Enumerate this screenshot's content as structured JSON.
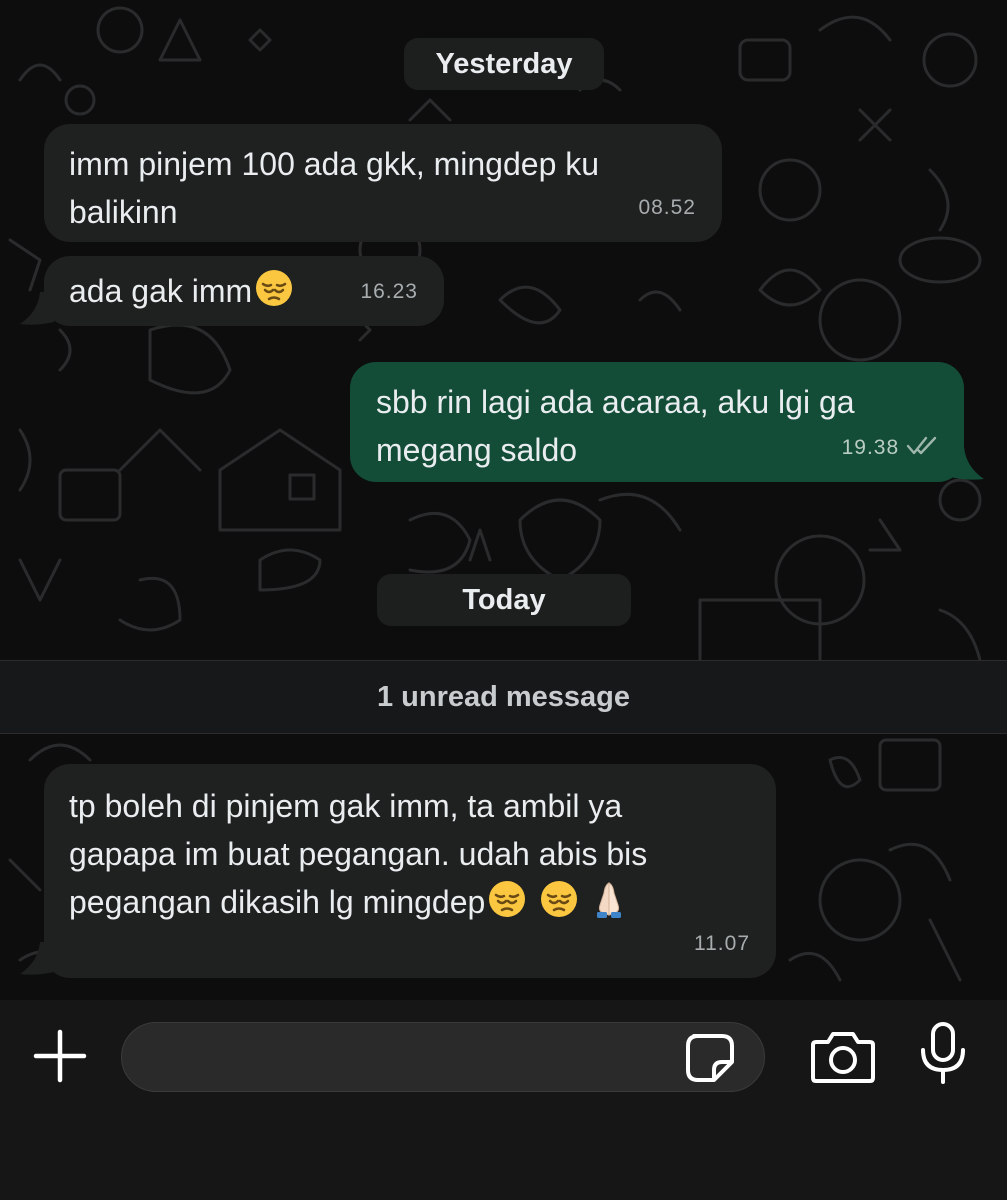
{
  "chat": {
    "date_yesterday": "Yesterday",
    "date_today": "Today",
    "unread_label": "1 unread message",
    "messages": [
      {
        "direction": "incoming",
        "line1": "imm pinjem 100 ada gkk, mingdep ku",
        "line2": "balikinn",
        "time": "08.52"
      },
      {
        "direction": "incoming",
        "text": "ada gak imm",
        "emojis": [
          "pensive-face"
        ],
        "time": "16.23"
      },
      {
        "direction": "outgoing",
        "line1": "sbb rin lagi ada acaraa, aku lgi ga",
        "line2": "megang saldo",
        "time": "19.38",
        "status": "read-double-check"
      },
      {
        "direction": "incoming",
        "line1": "tp boleh di pinjem gak imm, ta ambil ya",
        "line2": "gapapa im buat pegangan. udah abis bis",
        "line3": "pegangan dikasih lg mingdep",
        "emojis": [
          "pensive-face",
          "pensive-face",
          "folded-hands"
        ],
        "time": "11.07"
      }
    ]
  },
  "composer": {
    "placeholder": "",
    "value": "",
    "icons": [
      "plus-icon",
      "sticker-icon",
      "camera-icon",
      "microphone-icon"
    ]
  },
  "colors": {
    "background": "#0d0d0d",
    "incoming_bubble": "#1f2121",
    "outgoing_bubble": "#134d37",
    "date_pill": "#1d1f1f",
    "composer_bar": "#161616"
  }
}
